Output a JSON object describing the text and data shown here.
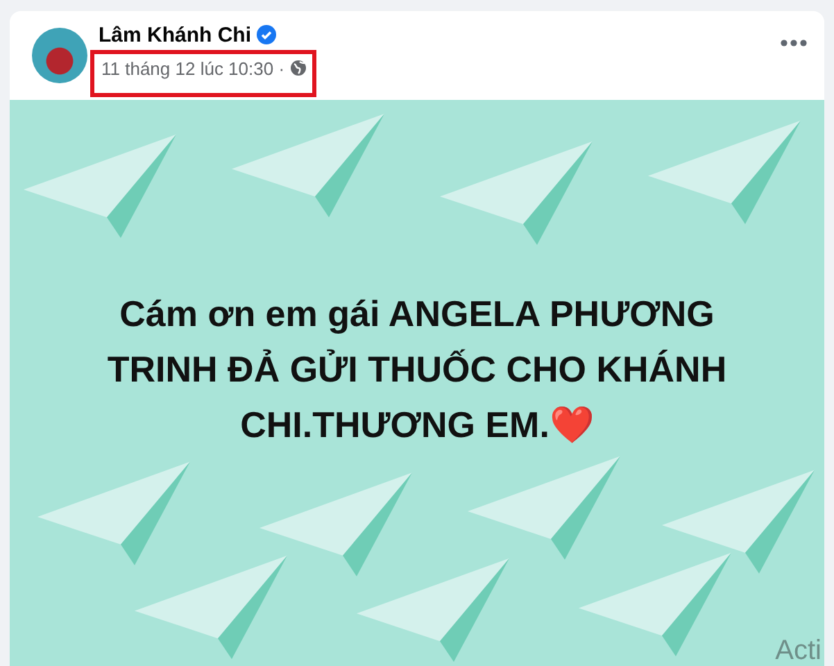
{
  "post": {
    "author": "Lâm Khánh Chi",
    "verified": true,
    "timestamp": "11 tháng 12 lúc 10:30 ·",
    "timestamp_highlighted": true,
    "image_text_lines": [
      "Cám ơn em gái ANGELA PHƯƠNG",
      "TRINH ĐẢ GỬI THUỐC CHO KHÁNH",
      "CHI.THƯƠNG EM.❤️"
    ]
  },
  "os_overlay_text": "Acti"
}
